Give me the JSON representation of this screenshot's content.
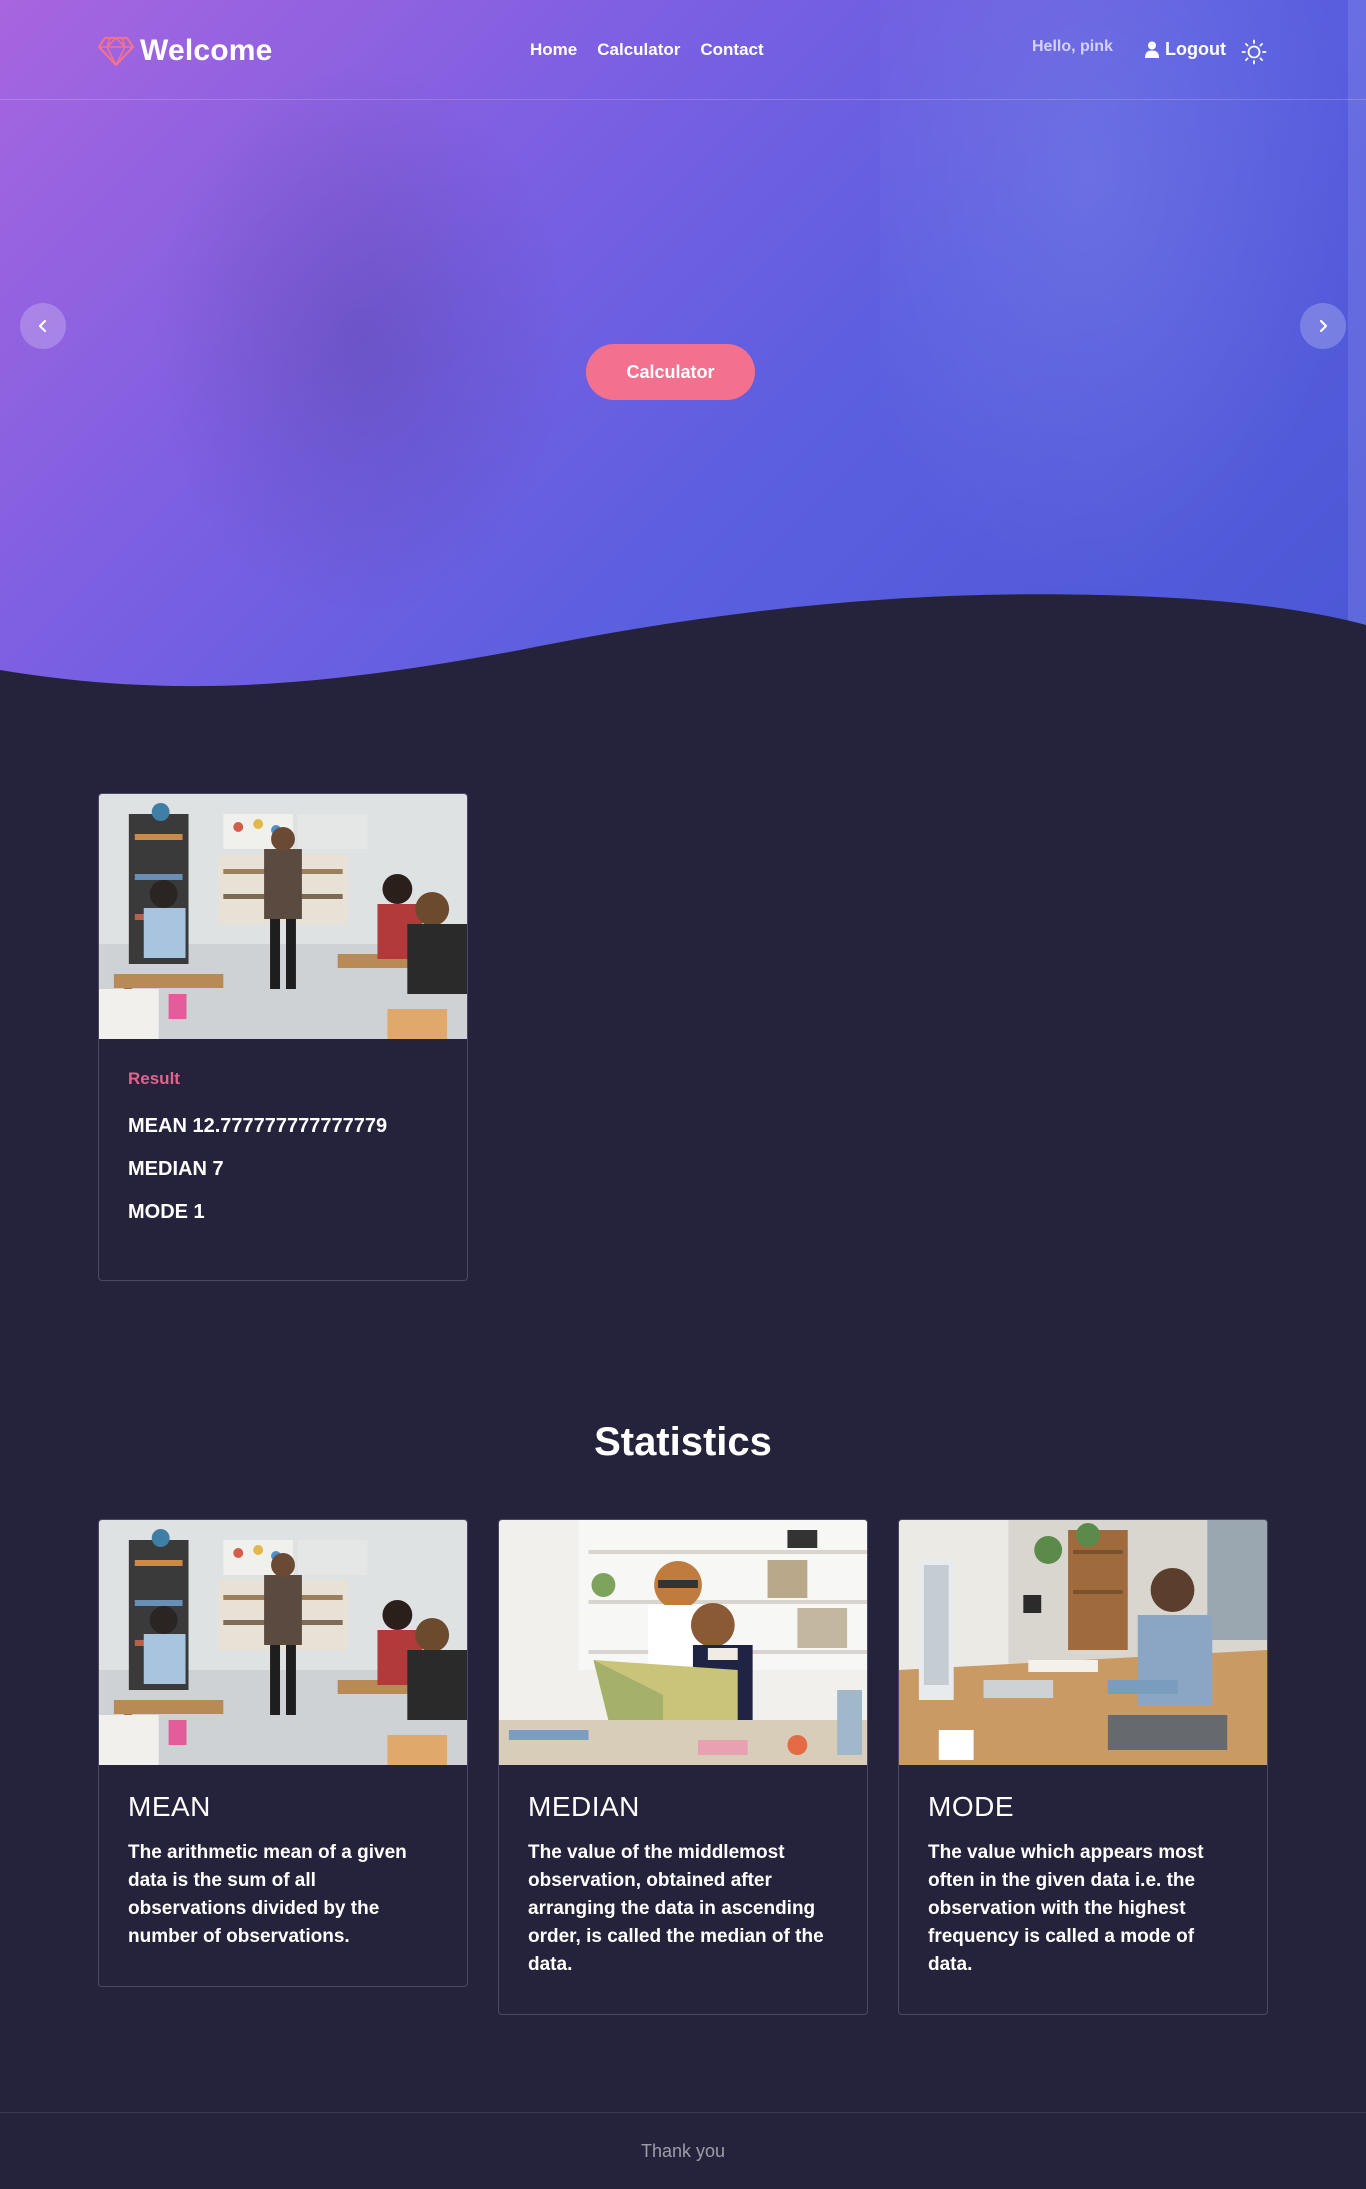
{
  "nav": {
    "brand": "Welcome",
    "links": [
      "Home",
      "Calculator",
      "Contact"
    ],
    "greeting": "Hello, pink",
    "logout": "Logout",
    "icons": {
      "brand": "diamond-icon",
      "user": "user-icon",
      "theme": "sun-icon"
    }
  },
  "hero": {
    "button": "Calculator",
    "prev_icon": "chevron-left-icon",
    "next_icon": "chevron-right-icon"
  },
  "result": {
    "label": "Result",
    "mean": "MEAN 12.777777777777779",
    "median": "MEDIAN 7",
    "mode": "MODE 1"
  },
  "statistics": {
    "title": "Statistics",
    "cards": [
      {
        "title": "MEAN",
        "text": "The arithmetic mean of a given data is the sum of all observations divided by the number of observations."
      },
      {
        "title": "MEDIAN",
        "text": "The value of the middlemost observation, obtained after arranging the data in ascending order, is called the median of the data."
      },
      {
        "title": "MODE",
        "text": "The value which appears most often in the given data i.e. the observation with the highest frequency is called a mode of data."
      }
    ]
  },
  "footer": {
    "text": "Thank you"
  },
  "colors": {
    "background": "#25233b",
    "hero_start": "#a865df",
    "hero_end": "#4b57d6",
    "accent_pink": "#f3708f",
    "result_label": "#e5628a"
  }
}
